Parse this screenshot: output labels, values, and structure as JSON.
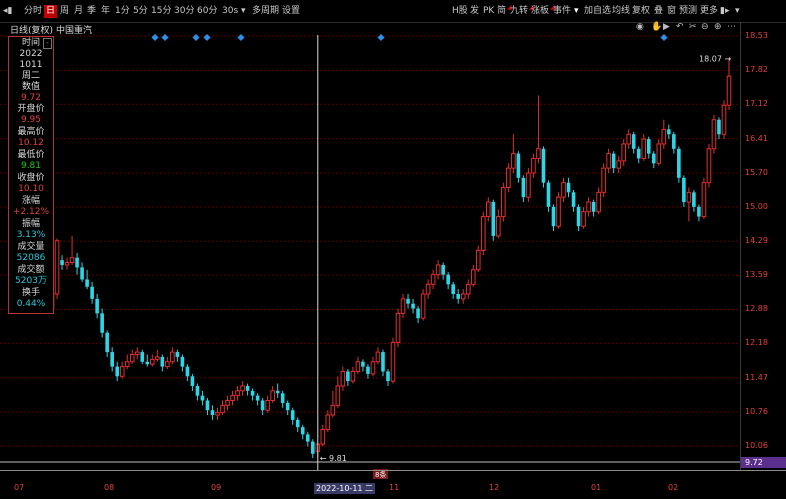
{
  "toolbar": {
    "left": [
      "分时",
      "日",
      "周",
      "月",
      "季",
      "年",
      "1分",
      "5分",
      "15分",
      "30分",
      "60分",
      "30s",
      "多周期",
      "设置"
    ],
    "active": "日",
    "right": [
      "H股",
      "发",
      "PK",
      "简",
      "九转",
      "涨板",
      "事件",
      "加自选",
      "均线",
      "复权",
      "叠",
      "窗",
      "预测",
      "更多"
    ]
  },
  "subtitle": {
    "mode": "日线(复权)",
    "name": "中国重汽"
  },
  "info_panel": [
    {
      "label": "时间",
      "value": "2022",
      "value2": "1011",
      "value3": "周二",
      "color": "lbl"
    },
    {
      "label": "数值",
      "value": "9.72",
      "color": "red"
    },
    {
      "label": "开盘价",
      "value": "9.95",
      "color": "red"
    },
    {
      "label": "最高价",
      "value": "10.12",
      "color": "red"
    },
    {
      "label": "最低价",
      "value": "9.81",
      "color": "green"
    },
    {
      "label": "收盘价",
      "value": "10.10",
      "color": "red"
    },
    {
      "label": "涨幅",
      "value": "+2.12%",
      "color": "red"
    },
    {
      "label": "振幅",
      "value": "3.13%",
      "color": "cyan"
    },
    {
      "label": "成交量",
      "value": "52086",
      "color": "cyan"
    },
    {
      "label": "成交额",
      "value": "5203万",
      "color": "cyan"
    },
    {
      "label": "换手",
      "value": "0.44%",
      "color": "cyan"
    }
  ],
  "price_axis": [
    "18.53",
    "17.82",
    "17.12",
    "16.41",
    "15.70",
    "15.00",
    "14.29",
    "13.59",
    "12.88",
    "12.18",
    "11.47",
    "10.76",
    "10.06"
  ],
  "last_price": "9.72",
  "x_axis": [
    "07",
    "08",
    "09",
    "2022-10-11 二",
    "11",
    "12",
    "01",
    "02"
  ],
  "annotations": {
    "max": "18.07",
    "min": "9.81",
    "badge": "8条"
  },
  "colors": {
    "up": "#e03030",
    "down": "#2cd6e6",
    "grid": "#5a0000",
    "marker": "#2e8fe6"
  },
  "chart_data": {
    "type": "candlestick",
    "ylim": [
      9.72,
      18.53
    ],
    "candles": [
      [
        12.88,
        13.2,
        13.3,
        12.8
      ],
      [
        13.2,
        14.3,
        14.35,
        13.1
      ],
      [
        13.9,
        13.8,
        14.0,
        13.7
      ],
      [
        13.8,
        13.85,
        13.95,
        13.7
      ],
      [
        13.85,
        13.95,
        14.4,
        13.8
      ],
      [
        13.95,
        13.75,
        14.05,
        13.6
      ],
      [
        13.75,
        13.5,
        13.85,
        13.45
      ],
      [
        13.5,
        13.35,
        13.7,
        13.3
      ],
      [
        13.35,
        13.1,
        13.45,
        13.0
      ],
      [
        13.1,
        12.8,
        13.2,
        12.7
      ],
      [
        12.8,
        12.4,
        12.9,
        12.3
      ],
      [
        12.4,
        12.0,
        12.45,
        11.9
      ],
      [
        12.0,
        11.7,
        12.1,
        11.6
      ],
      [
        11.7,
        11.5,
        11.8,
        11.4
      ],
      [
        11.5,
        11.7,
        11.8,
        11.45
      ],
      [
        11.7,
        11.8,
        11.95,
        11.65
      ],
      [
        11.8,
        11.95,
        12.05,
        11.75
      ],
      [
        11.95,
        12.0,
        12.1,
        11.85
      ],
      [
        12.0,
        11.8,
        12.05,
        11.75
      ],
      [
        11.8,
        11.75,
        11.95,
        11.7
      ],
      [
        11.75,
        11.85,
        11.95,
        11.7
      ],
      [
        11.85,
        11.9,
        12.05,
        11.8
      ],
      [
        11.9,
        11.7,
        11.95,
        11.6
      ],
      [
        11.7,
        11.8,
        11.9,
        11.65
      ],
      [
        11.8,
        12.0,
        12.1,
        11.75
      ],
      [
        12.0,
        11.9,
        12.05,
        11.8
      ],
      [
        11.9,
        11.7,
        11.95,
        11.6
      ],
      [
        11.7,
        11.5,
        11.75,
        11.4
      ],
      [
        11.5,
        11.3,
        11.55,
        11.2
      ],
      [
        11.3,
        11.1,
        11.35,
        11.0
      ],
      [
        11.1,
        11.0,
        11.2,
        10.9
      ],
      [
        11.0,
        10.8,
        11.05,
        10.7
      ],
      [
        10.8,
        10.7,
        10.9,
        10.6
      ],
      [
        10.7,
        10.75,
        10.85,
        10.6
      ],
      [
        10.75,
        10.9,
        11.0,
        10.7
      ],
      [
        10.9,
        11.0,
        11.1,
        10.8
      ],
      [
        11.0,
        11.1,
        11.2,
        10.9
      ],
      [
        11.1,
        11.2,
        11.3,
        11.0
      ],
      [
        11.2,
        11.3,
        11.4,
        11.1
      ],
      [
        11.3,
        11.2,
        11.35,
        11.1
      ],
      [
        11.2,
        11.1,
        11.25,
        11.0
      ],
      [
        11.1,
        11.0,
        11.15,
        10.9
      ],
      [
        11.0,
        10.8,
        11.05,
        10.7
      ],
      [
        10.8,
        11.0,
        11.1,
        10.75
      ],
      [
        11.0,
        11.2,
        11.3,
        10.95
      ],
      [
        11.2,
        11.15,
        11.35,
        11.05
      ],
      [
        11.15,
        10.95,
        11.2,
        10.85
      ],
      [
        10.95,
        10.8,
        11.0,
        10.7
      ],
      [
        10.8,
        10.6,
        10.85,
        10.5
      ],
      [
        10.6,
        10.45,
        10.65,
        10.35
      ],
      [
        10.45,
        10.3,
        10.5,
        10.2
      ],
      [
        10.3,
        10.15,
        10.35,
        10.05
      ],
      [
        10.15,
        9.9,
        10.2,
        9.81
      ],
      [
        9.95,
        10.1,
        10.12,
        9.81
      ],
      [
        10.1,
        10.4,
        10.5,
        10.05
      ],
      [
        10.4,
        10.7,
        10.8,
        10.35
      ],
      [
        10.7,
        10.9,
        11.2,
        10.65
      ],
      [
        10.9,
        11.3,
        11.5,
        10.85
      ],
      [
        11.3,
        11.6,
        11.7,
        11.2
      ],
      [
        11.6,
        11.4,
        11.65,
        11.3
      ],
      [
        11.4,
        11.6,
        11.7,
        11.35
      ],
      [
        11.6,
        11.8,
        11.9,
        11.55
      ],
      [
        11.8,
        11.7,
        11.85,
        11.6
      ],
      [
        11.7,
        11.55,
        11.75,
        11.45
      ],
      [
        11.55,
        11.8,
        11.9,
        11.5
      ],
      [
        11.8,
        12.0,
        12.1,
        11.75
      ],
      [
        12.0,
        11.6,
        12.05,
        11.5
      ],
      [
        11.6,
        11.4,
        11.65,
        11.3
      ],
      [
        11.4,
        12.2,
        12.3,
        11.35
      ],
      [
        12.2,
        12.8,
        12.9,
        12.1
      ],
      [
        12.8,
        13.1,
        13.2,
        12.7
      ],
      [
        13.1,
        13.0,
        13.2,
        12.9
      ],
      [
        13.0,
        12.9,
        13.1,
        12.8
      ],
      [
        12.9,
        12.7,
        12.95,
        12.6
      ],
      [
        12.7,
        13.2,
        13.3,
        12.65
      ],
      [
        13.2,
        13.4,
        13.5,
        13.1
      ],
      [
        13.4,
        13.6,
        13.7,
        13.3
      ],
      [
        13.6,
        13.8,
        13.9,
        13.5
      ],
      [
        13.8,
        13.6,
        13.85,
        13.5
      ],
      [
        13.6,
        13.4,
        13.65,
        13.3
      ],
      [
        13.4,
        13.2,
        13.45,
        13.1
      ],
      [
        13.2,
        13.1,
        13.3,
        13.0
      ],
      [
        13.1,
        13.2,
        13.3,
        13.0
      ],
      [
        13.2,
        13.4,
        13.5,
        13.1
      ],
      [
        13.4,
        13.7,
        13.8,
        13.35
      ],
      [
        13.7,
        14.1,
        14.2,
        13.65
      ],
      [
        14.1,
        14.8,
        14.9,
        14.0
      ],
      [
        14.8,
        15.1,
        15.2,
        14.7
      ],
      [
        15.1,
        14.4,
        15.15,
        14.3
      ],
      [
        14.4,
        14.8,
        14.95,
        14.35
      ],
      [
        14.8,
        15.4,
        15.5,
        14.7
      ],
      [
        15.4,
        15.8,
        15.9,
        15.3
      ],
      [
        15.8,
        16.1,
        16.5,
        15.7
      ],
      [
        16.1,
        15.6,
        16.15,
        15.5
      ],
      [
        15.6,
        15.2,
        15.65,
        15.1
      ],
      [
        15.2,
        15.7,
        15.8,
        15.1
      ],
      [
        15.7,
        16.0,
        16.1,
        15.6
      ],
      [
        16.0,
        16.2,
        17.3,
        15.9
      ],
      [
        16.2,
        15.5,
        16.25,
        15.4
      ],
      [
        15.5,
        15.0,
        15.55,
        14.9
      ],
      [
        15.0,
        14.6,
        15.05,
        14.5
      ],
      [
        14.6,
        15.2,
        15.3,
        14.55
      ],
      [
        15.2,
        15.5,
        15.6,
        15.1
      ],
      [
        15.5,
        15.3,
        15.6,
        15.2
      ],
      [
        15.3,
        15.0,
        15.35,
        14.9
      ],
      [
        15.0,
        14.6,
        15.05,
        14.5
      ],
      [
        14.6,
        14.9,
        15.0,
        14.55
      ],
      [
        14.9,
        15.1,
        15.2,
        14.8
      ],
      [
        15.1,
        14.9,
        15.15,
        14.8
      ],
      [
        14.9,
        15.3,
        15.4,
        14.85
      ],
      [
        15.3,
        15.8,
        15.9,
        15.2
      ],
      [
        15.8,
        16.1,
        16.2,
        15.7
      ],
      [
        16.1,
        15.8,
        16.15,
        15.7
      ],
      [
        15.8,
        15.95,
        16.05,
        15.7
      ],
      [
        15.95,
        16.3,
        16.4,
        15.85
      ],
      [
        16.3,
        16.5,
        16.6,
        16.2
      ],
      [
        16.5,
        16.2,
        16.55,
        16.1
      ],
      [
        16.2,
        16.0,
        16.25,
        15.9
      ],
      [
        16.0,
        16.4,
        16.5,
        15.95
      ],
      [
        16.4,
        16.1,
        16.45,
        16.0
      ],
      [
        16.1,
        15.9,
        16.15,
        15.8
      ],
      [
        15.9,
        16.3,
        16.4,
        15.85
      ],
      [
        16.3,
        16.6,
        16.8,
        16.2
      ],
      [
        16.6,
        16.5,
        16.7,
        16.4
      ],
      [
        16.5,
        16.2,
        16.55,
        16.1
      ],
      [
        16.2,
        15.6,
        16.25,
        15.5
      ],
      [
        15.6,
        15.1,
        15.65,
        15.0
      ],
      [
        15.1,
        15.3,
        15.4,
        14.7
      ],
      [
        15.3,
        15.0,
        15.35,
        14.9
      ],
      [
        15.0,
        14.8,
        15.05,
        14.7
      ],
      [
        14.8,
        15.5,
        15.6,
        14.75
      ],
      [
        15.5,
        16.2,
        16.3,
        15.4
      ],
      [
        16.2,
        16.8,
        16.9,
        16.1
      ],
      [
        16.8,
        16.5,
        16.85,
        16.4
      ],
      [
        16.5,
        17.1,
        17.2,
        16.4
      ],
      [
        17.1,
        17.7,
        18.07,
        17.0
      ]
    ]
  }
}
